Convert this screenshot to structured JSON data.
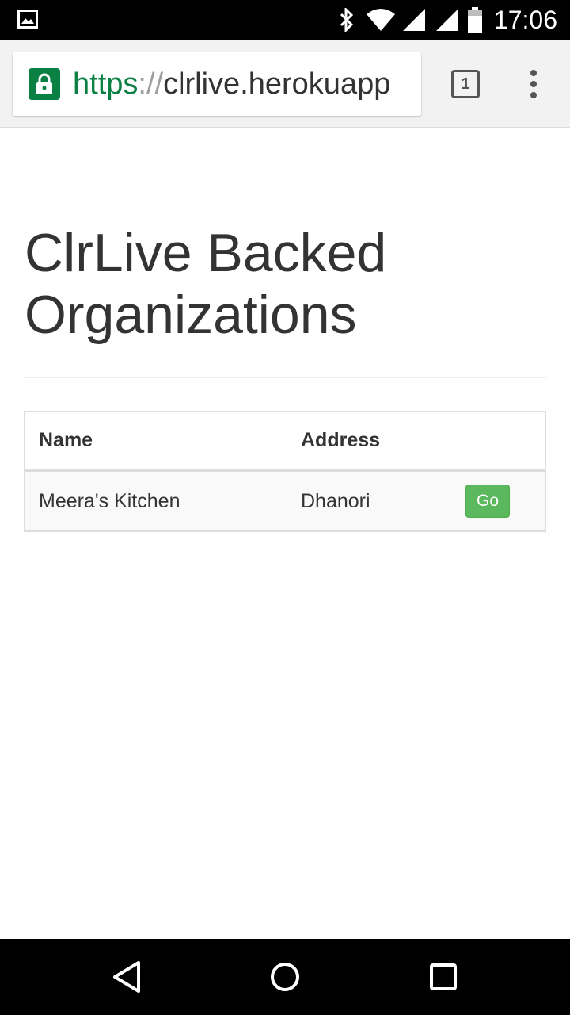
{
  "status_bar": {
    "time": "17:06",
    "icons": [
      "image-notification-icon",
      "bluetooth-icon",
      "wifi-icon",
      "signal-icon",
      "signal-icon",
      "battery-icon"
    ]
  },
  "browser": {
    "url_scheme": "https",
    "url_separator": "://",
    "url_host": "clrlive.herokuapp",
    "tab_count": "1",
    "accent_color": "#0b8043"
  },
  "page": {
    "title": "ClrLive Backed Organizations",
    "table": {
      "headers": [
        "Name",
        "Address",
        ""
      ],
      "rows": [
        {
          "name": "Meera's Kitchen",
          "address": "Dhanori",
          "action_label": "Go"
        }
      ]
    },
    "button_color": "#5cb85c"
  },
  "nav_bar": {
    "buttons": [
      "back-icon",
      "home-icon",
      "recents-icon"
    ]
  }
}
